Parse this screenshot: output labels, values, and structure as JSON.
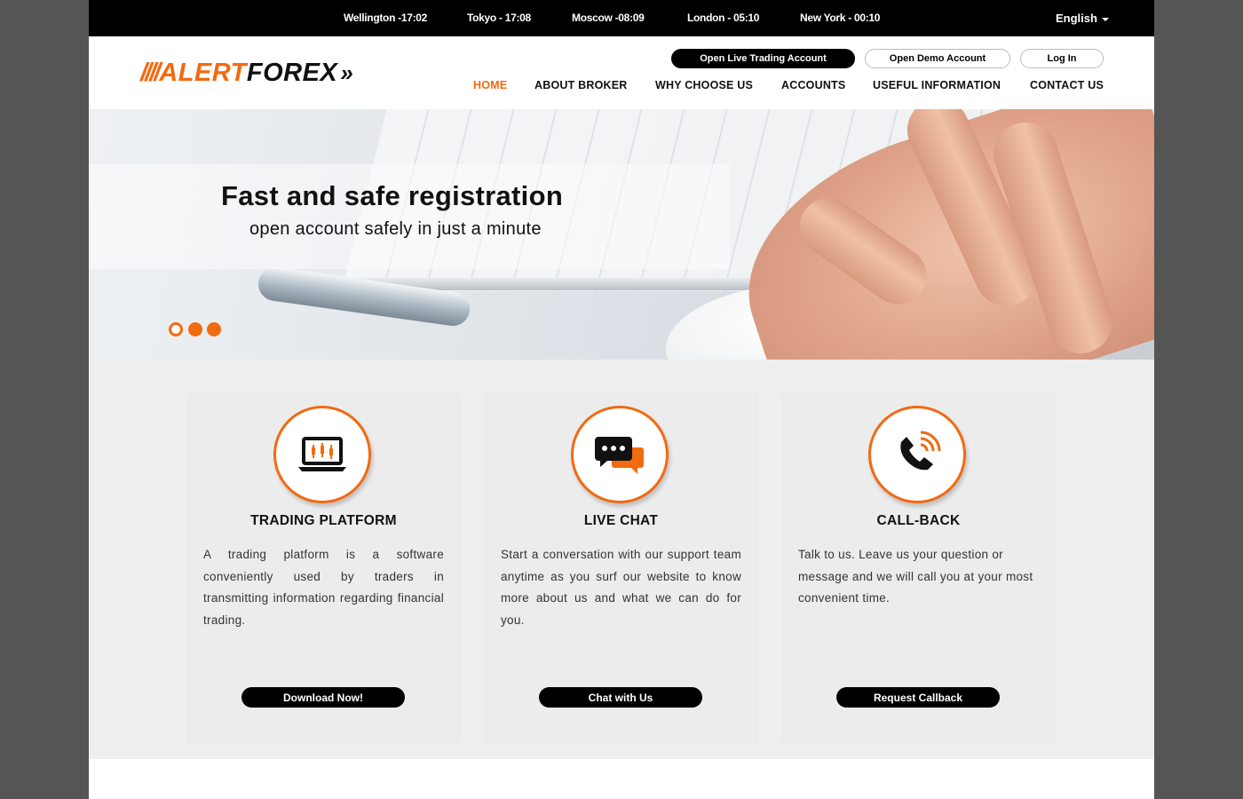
{
  "clocks": [
    {
      "label": "Wellington -17:02"
    },
    {
      "label": "Tokyo - 17:08"
    },
    {
      "label": "Moscow -08:09"
    },
    {
      "label": "London - 05:10"
    },
    {
      "label": "New York - 00:10"
    }
  ],
  "language": {
    "selected": "English"
  },
  "logo": {
    "slashes": "////",
    "alert": "ALERT",
    "forex": "FOREX",
    "chevrons": "»"
  },
  "account_buttons": {
    "live": "Open Live Trading Account",
    "demo": "Open Demo Account",
    "login": "Log In"
  },
  "nav": [
    {
      "label": "HOME",
      "active": true
    },
    {
      "label": "ABOUT BROKER"
    },
    {
      "label": "WHY CHOOSE US"
    },
    {
      "label": "ACCOUNTS"
    },
    {
      "label": "USEFUL INFORMATION"
    },
    {
      "label": "CONTACT US"
    }
  ],
  "hero": {
    "title": "Fast and safe registration",
    "subtitle": "open account safely in just a minute",
    "slides": 3,
    "current_slide": 1
  },
  "features": [
    {
      "icon": "trading-platform-icon",
      "title": "TRADING PLATFORM",
      "text": "A trading platform is a software conveniently used by traders in transmitting information regarding financial trading.",
      "button": "Download Now!"
    },
    {
      "icon": "live-chat-icon",
      "title": "LIVE CHAT",
      "text": "Start a conversation with our support team anytime as you surf our website to know more about us and what we can do for you.",
      "button": "Chat with Us"
    },
    {
      "icon": "phone-callback-icon",
      "title": "CALL-BACK",
      "text": "Talk to us. Leave us your question or message and we will call you at your most convenient time.",
      "button": "Request Callback"
    }
  ],
  "colors": {
    "accent": "#f26a10",
    "dark": "#000000",
    "background": "#eeeeee"
  }
}
